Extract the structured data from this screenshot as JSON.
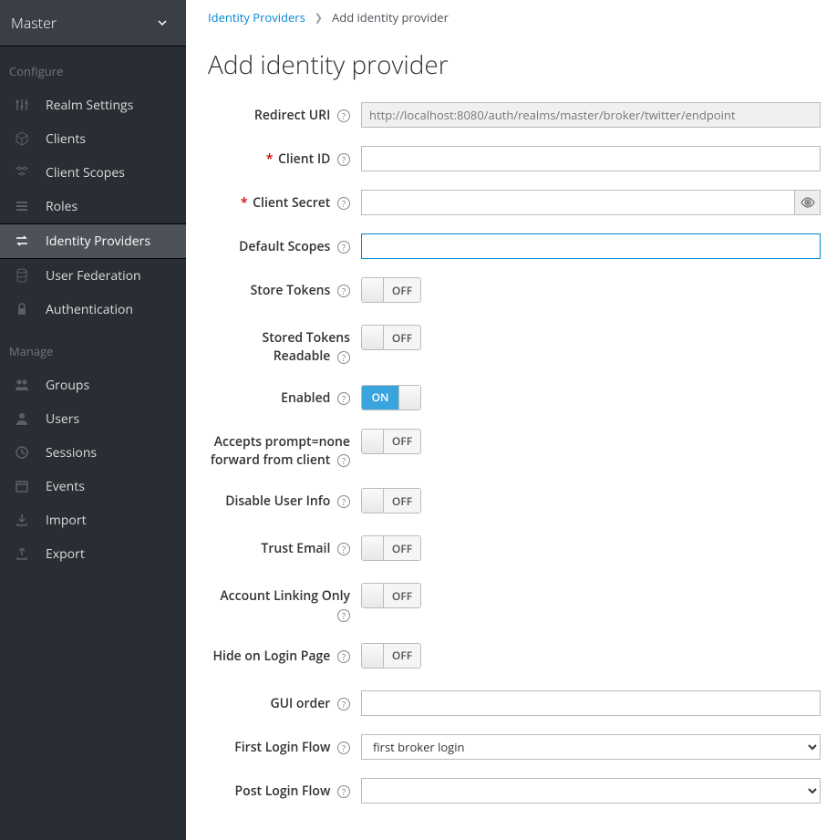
{
  "realm": {
    "name": "Master"
  },
  "sidebar": {
    "configure_header": "Configure",
    "manage_header": "Manage",
    "configure": [
      {
        "label": "Realm Settings",
        "icon": "sliders"
      },
      {
        "label": "Clients",
        "icon": "cube"
      },
      {
        "label": "Client Scopes",
        "icon": "cubes"
      },
      {
        "label": "Roles",
        "icon": "list"
      },
      {
        "label": "Identity Providers",
        "icon": "exchange",
        "active": true
      },
      {
        "label": "User Federation",
        "icon": "database"
      },
      {
        "label": "Authentication",
        "icon": "lock"
      }
    ],
    "manage": [
      {
        "label": "Groups",
        "icon": "group"
      },
      {
        "label": "Users",
        "icon": "user"
      },
      {
        "label": "Sessions",
        "icon": "clock"
      },
      {
        "label": "Events",
        "icon": "calendar"
      },
      {
        "label": "Import",
        "icon": "import"
      },
      {
        "label": "Export",
        "icon": "export"
      }
    ]
  },
  "breadcrumb": {
    "root": "Identity Providers",
    "current": "Add identity provider"
  },
  "page": {
    "title": "Add identity provider"
  },
  "form": {
    "redirect_uri": {
      "label": "Redirect URI",
      "value": "http://localhost:8080/auth/realms/master/broker/twitter/endpoint"
    },
    "client_id": {
      "label": "Client ID",
      "required": true,
      "value": ""
    },
    "client_secret": {
      "label": "Client Secret",
      "required": true,
      "value": ""
    },
    "default_scopes": {
      "label": "Default Scopes",
      "value": ""
    },
    "store_tokens": {
      "label": "Store Tokens",
      "value": "OFF"
    },
    "stored_tokens_readable": {
      "label": "Stored Tokens Readable",
      "value": "OFF"
    },
    "enabled": {
      "label": "Enabled",
      "value": "ON"
    },
    "accepts_prompt_none": {
      "label": "Accepts prompt=none forward from client",
      "value": "OFF"
    },
    "disable_user_info": {
      "label": "Disable User Info",
      "value": "OFF"
    },
    "trust_email": {
      "label": "Trust Email",
      "value": "OFF"
    },
    "account_linking_only": {
      "label": "Account Linking Only",
      "value": "OFF"
    },
    "hide_on_login_page": {
      "label": "Hide on Login Page",
      "value": "OFF"
    },
    "gui_order": {
      "label": "GUI order",
      "value": ""
    },
    "first_login_flow": {
      "label": "First Login Flow",
      "value": "first broker login"
    },
    "post_login_flow": {
      "label": "Post Login Flow",
      "value": ""
    }
  },
  "toggle_labels": {
    "on": "ON",
    "off": "OFF"
  }
}
